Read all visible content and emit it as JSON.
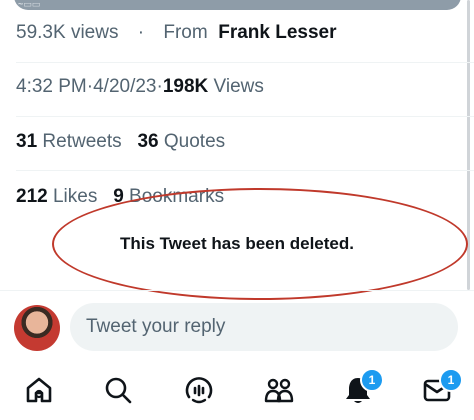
{
  "stats": {
    "views_count": "59.3K",
    "views_label": "views",
    "separator": "·",
    "from_label": "From",
    "from_name": "Frank Lesser",
    "time": "4:32 PM",
    "date": "4/20/23",
    "total_views_count": "198K",
    "total_views_label": "Views",
    "retweets_count": "31",
    "retweets_label": "Retweets",
    "quotes_count": "36",
    "quotes_label": "Quotes",
    "likes_count": "212",
    "likes_label": "Likes",
    "bookmarks_count": "9",
    "bookmarks_label": "Bookmarks"
  },
  "annotation": {
    "message": "This Tweet has been deleted.",
    "color": "#c0392b"
  },
  "reply": {
    "placeholder": "Tweet your reply"
  },
  "tabbar": {
    "items": [
      {
        "icon": "home-icon"
      },
      {
        "icon": "search-icon"
      },
      {
        "icon": "spaces-icon"
      },
      {
        "icon": "communities-icon"
      },
      {
        "icon": "notifications-icon",
        "badge": "1"
      },
      {
        "icon": "messages-icon",
        "badge": "1"
      }
    ]
  },
  "colors": {
    "accent": "#1d9bf0",
    "text": "#0f1419",
    "muted": "#536471"
  }
}
